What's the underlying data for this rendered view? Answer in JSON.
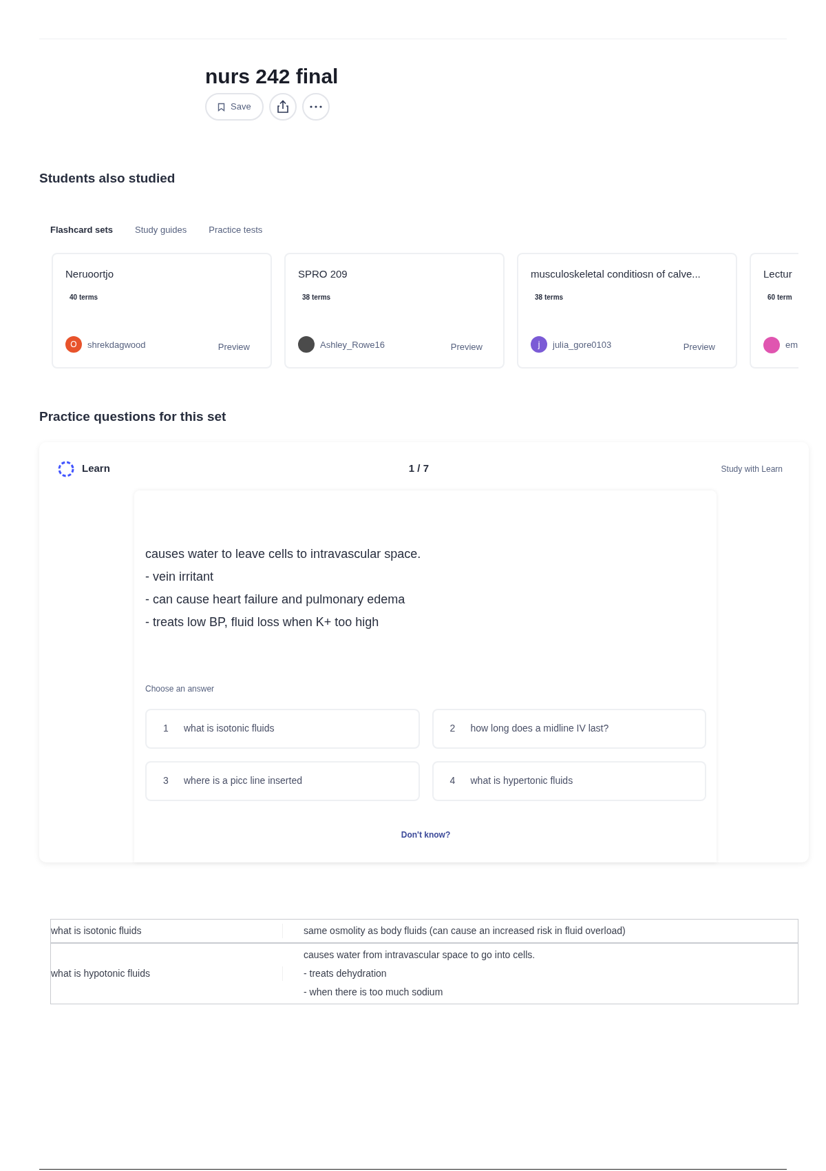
{
  "set": {
    "title": "nurs 242 final",
    "buttons": [
      {
        "kind": "save",
        "label": "Save"
      },
      {
        "kind": "share"
      },
      {
        "kind": "more"
      }
    ]
  },
  "also_studied": {
    "heading": "Students also studied",
    "tabs": [
      {
        "label": "Flashcard sets",
        "selected": true
      },
      {
        "label": "Study guides",
        "selected": false
      },
      {
        "label": "Practice tests",
        "selected": false
      }
    ],
    "cards": [
      {
        "title": "Neruoortjo",
        "terms": "40 terms",
        "author": "shrekdagwood",
        "avatar": {
          "kind": "letter",
          "text": "O",
          "color": "#e8532b"
        },
        "preview": "Preview",
        "cut": false
      },
      {
        "title": "SPRO 209",
        "terms": "38 terms",
        "author": "Ashley_Rowe16",
        "avatar": {
          "kind": "photo",
          "color": "#4b4b4b"
        },
        "preview": "Preview",
        "cut": false
      },
      {
        "title": "musculoskeletal conditiosn of calve...",
        "terms": "38 terms",
        "author": "julia_gore0103",
        "avatar": {
          "kind": "letter",
          "text": "j",
          "color": "#7b5bd6"
        },
        "preview": "Preview",
        "cut": false
      },
      {
        "title": "Lectur",
        "terms": "60 term",
        "author": "em",
        "avatar": {
          "kind": "photo",
          "color": "#e055b0"
        },
        "cut": true
      }
    ]
  },
  "practice": {
    "heading": "Practice questions for this set",
    "mode": "Learn",
    "progress": "1 / 7",
    "study_link": "Study with Learn",
    "question": [
      "causes water to leave cells to intravascular space.",
      "- vein irritant",
      "- can cause heart failure and pulmonary edema",
      "- treats low BP, fluid loss when K+ too high"
    ],
    "prompt": "Choose an answer",
    "answers": [
      {
        "number": "1",
        "text": "what is isotonic fluids"
      },
      {
        "number": "2",
        "text": "how long does a midline IV last?"
      },
      {
        "number": "3",
        "text": "where is a picc line inserted"
      },
      {
        "number": "4",
        "text": "what is hypertonic fluids"
      }
    ],
    "dont_know": "Don't know?"
  },
  "terms_table": {
    "rows": [
      {
        "term": "what is isotonic fluids",
        "definition": [
          "same osmolity as body fluids (can cause an increased risk in fluid overload)"
        ]
      },
      {
        "term": "what is hypotonic fluids",
        "definition": [
          "causes water from intravascular space to go into cells.",
          "- treats dehydration",
          "- when there is too much sodium"
        ]
      }
    ]
  }
}
